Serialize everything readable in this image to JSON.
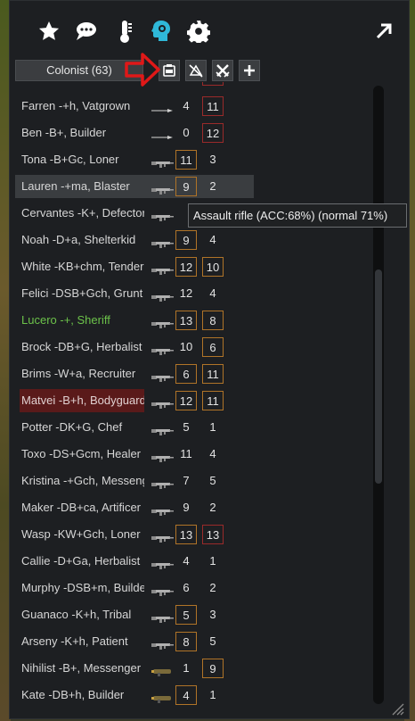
{
  "top_icons": [
    "star-icon",
    "chat-bubbles-icon",
    "thermometer-icon",
    "head-cog-icon",
    "gear-icon"
  ],
  "expand_icon": "expand-arrow-icon",
  "header": {
    "colonist_button": "Colonist (63)",
    "buttons": [
      "inventory-icon",
      "no-range-icon",
      "crossed-swords-icon",
      "plus-icon"
    ]
  },
  "rows": [
    {
      "name": "Farren -+h, Vatgrown",
      "weapon": "spear",
      "c1": "4",
      "c2": "11"
    },
    {
      "name": "Ben -B+, Builder",
      "weapon": "spear",
      "c1": "0",
      "c2": "12"
    },
    {
      "name": "Tona -B+Gc, Loner",
      "weapon": "rifle",
      "c1": "11",
      "c2": "3"
    },
    {
      "name": "Lauren -+ma, Blaster",
      "weapon": "rifle",
      "c1": "9",
      "c2": "2"
    },
    {
      "name": "Cervantes -K+, Defector",
      "weapon": "rifle",
      "c1": "",
      "c2": ""
    },
    {
      "name": "Noah -D+a, Shelterkid",
      "weapon": "rifle",
      "c1": "9",
      "c2": "4"
    },
    {
      "name": "White -KB+chm, Tender",
      "weapon": "rifle",
      "c1": "12",
      "c2": "10"
    },
    {
      "name": "Felici -DSB+Gch, Grunt",
      "weapon": "rifle",
      "c1": "12",
      "c2": "4"
    },
    {
      "name": "Lucero -+, Sheriff",
      "weapon": "rifle",
      "c1": "13",
      "c2": "8"
    },
    {
      "name": "Brock -DB+G, Herbalist",
      "weapon": "rifle",
      "c1": "10",
      "c2": "6"
    },
    {
      "name": "Brims -W+a, Recruiter",
      "weapon": "rifle",
      "c1": "6",
      "c2": "11"
    },
    {
      "name": "Matvei -B+h, Bodyguard",
      "weapon": "rifle",
      "c1": "12",
      "c2": "11"
    },
    {
      "name": "Potter -DK+G, Chef",
      "weapon": "rifle",
      "c1": "5",
      "c2": "1"
    },
    {
      "name": "Toxo -DS+Gcm, Healer",
      "weapon": "rifle",
      "c1": "11",
      "c2": "4"
    },
    {
      "name": "Kristina -+Gch, Messenger",
      "weapon": "rifle",
      "c1": "7",
      "c2": "5"
    },
    {
      "name": "Maker -DB+ca, Artificer",
      "weapon": "rifle",
      "c1": "9",
      "c2": "2"
    },
    {
      "name": "Wasp -KW+Gch, Loner",
      "weapon": "rifle",
      "c1": "13",
      "c2": "13"
    },
    {
      "name": "Callie -D+Ga, Herbalist",
      "weapon": "rifle",
      "c1": "4",
      "c2": "1"
    },
    {
      "name": "Murphy -DSB+m, Builder",
      "weapon": "rifle",
      "c1": "6",
      "c2": "2"
    },
    {
      "name": "Guanaco -K+h, Tribal",
      "weapon": "rifle",
      "c1": "5",
      "c2": "3"
    },
    {
      "name": "Arseny -K+h, Patient",
      "weapon": "rifle",
      "c1": "8",
      "c2": "5"
    },
    {
      "name": "Nihilist -B+, Messenger",
      "weapon": "launcher",
      "c1": "1",
      "c2": "9"
    },
    {
      "name": "Kate -DB+h, Builder",
      "weapon": "launcher",
      "c1": "4",
      "c2": "1"
    }
  ],
  "tooltip": "Assault rifle (ACC:68%) (normal 71%)"
}
